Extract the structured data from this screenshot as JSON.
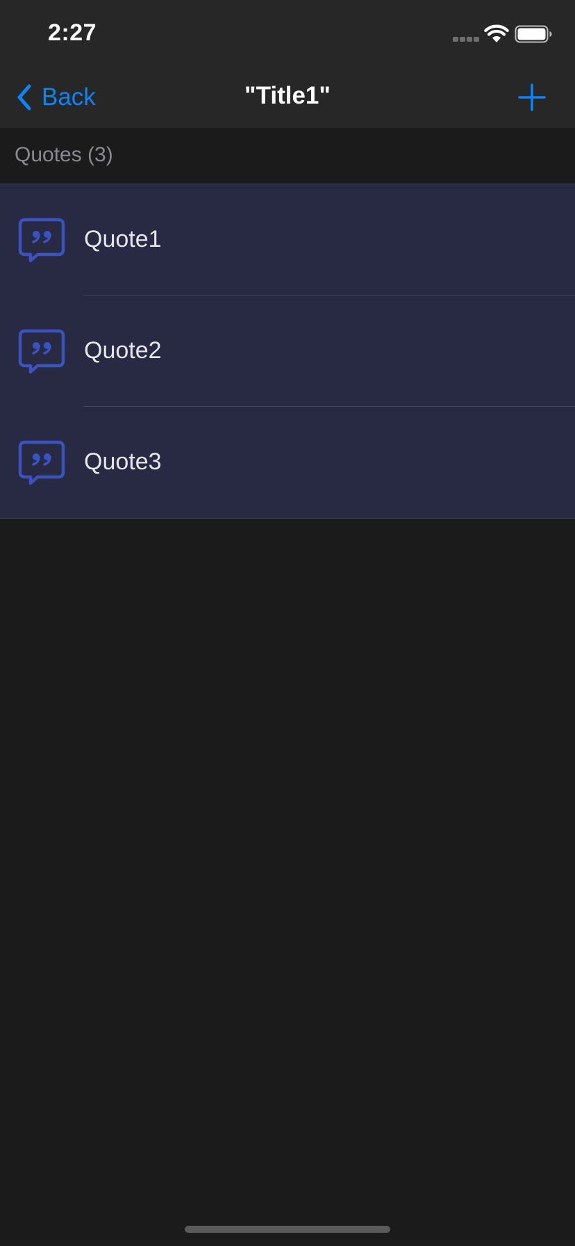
{
  "status_bar": {
    "time": "2:27"
  },
  "nav": {
    "back_label": "Back",
    "title": "\"Title1\"",
    "add_icon": "plus-icon"
  },
  "section": {
    "title": "Quotes (3)"
  },
  "items": [
    {
      "label": "Quote1",
      "icon": "quote-bubble-icon"
    },
    {
      "label": "Quote2",
      "icon": "quote-bubble-icon"
    },
    {
      "label": "Quote3",
      "icon": "quote-bubble-icon"
    }
  ],
  "colors": {
    "accent": "#0a84ff",
    "icon": "#3a52c2",
    "list_bg": "#282a43",
    "bar_bg": "#272727",
    "page_bg": "#1b1b1b"
  }
}
